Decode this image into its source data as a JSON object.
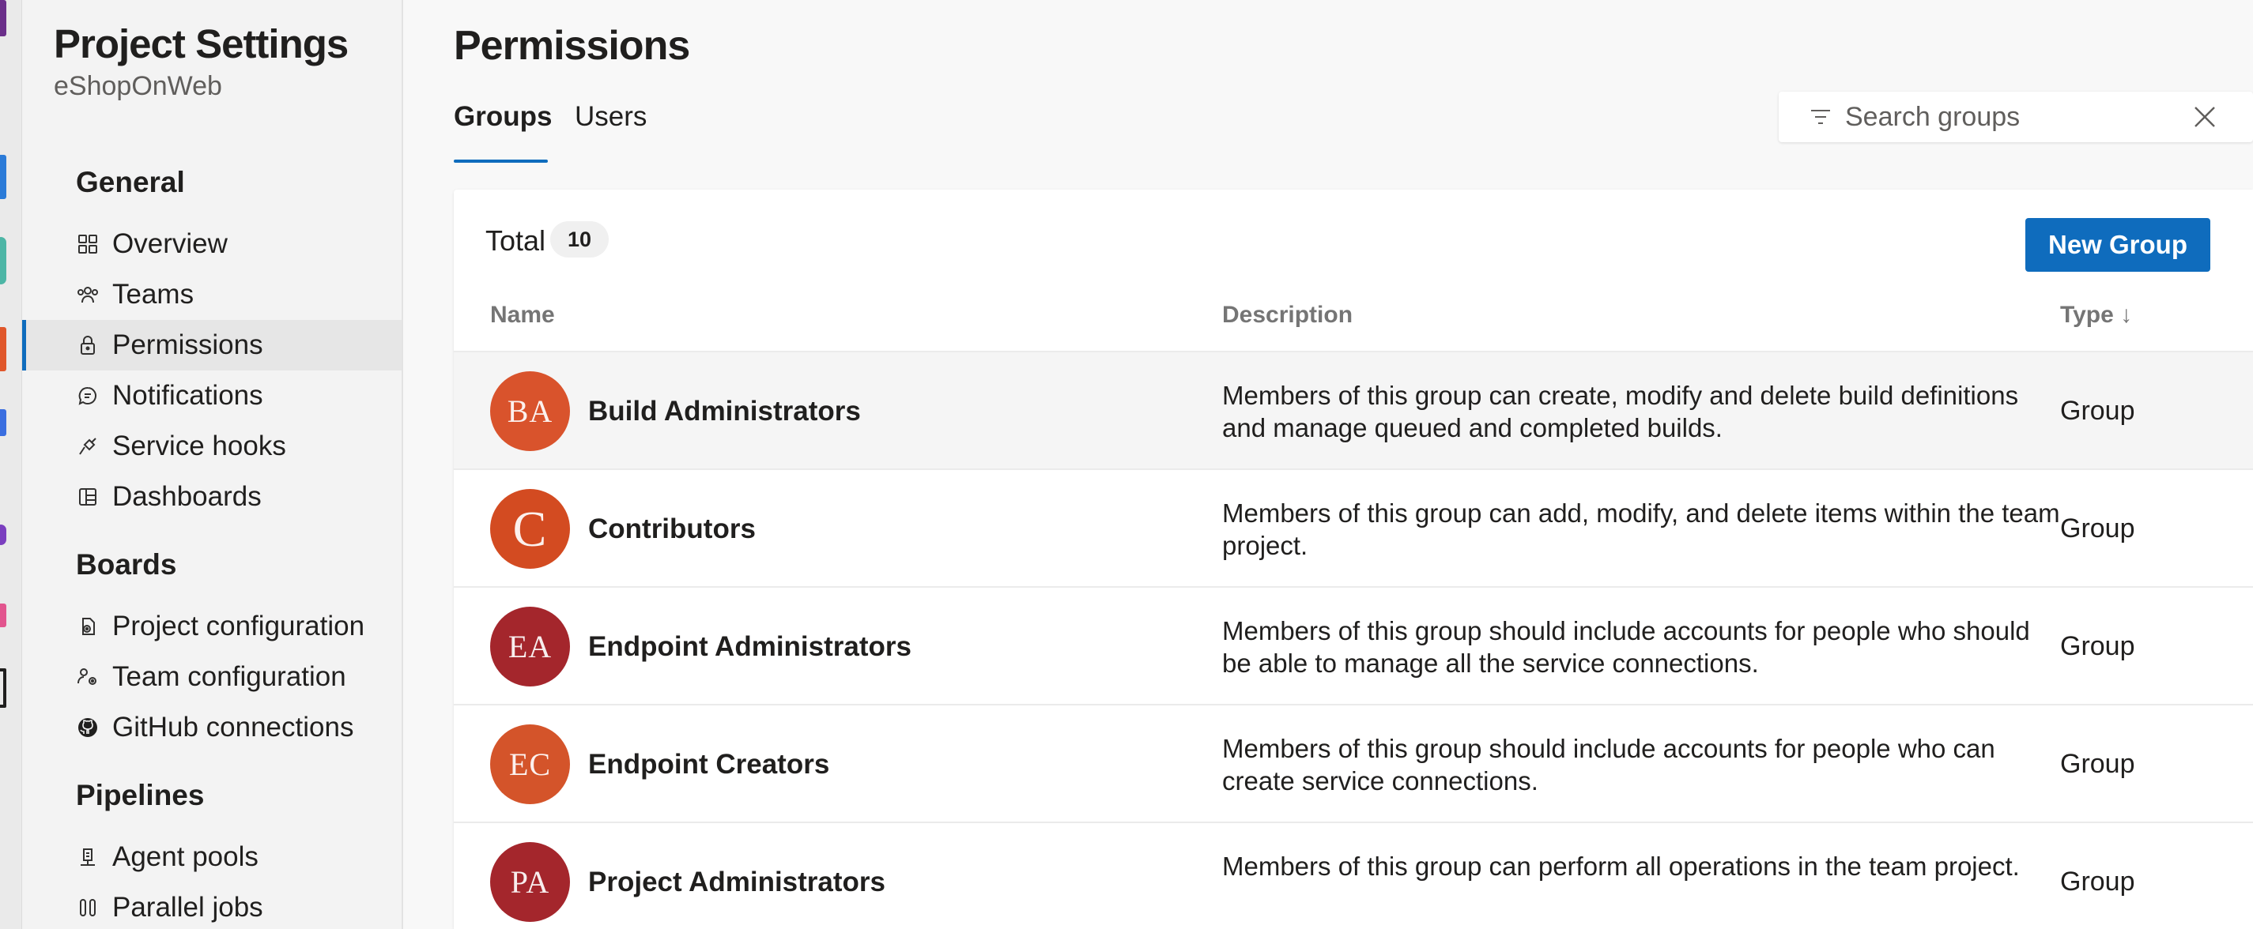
{
  "sidebar": {
    "title": "Project Settings",
    "subtitle": "eShopOnWeb",
    "sections": {
      "general": "General",
      "boards": "Boards",
      "pipelines": "Pipelines"
    },
    "general_items": [
      {
        "label": "Overview",
        "icon": "overview-icon"
      },
      {
        "label": "Teams",
        "icon": "teams-icon"
      },
      {
        "label": "Permissions",
        "icon": "lock-icon",
        "selected": true
      },
      {
        "label": "Notifications",
        "icon": "chat-bubble-icon"
      },
      {
        "label": "Service hooks",
        "icon": "plug-icon"
      },
      {
        "label": "Dashboards",
        "icon": "dashboard-icon"
      }
    ],
    "boards_items": [
      {
        "label": "Project configuration",
        "icon": "gear-doc-icon"
      },
      {
        "label": "Team configuration",
        "icon": "team-gear-icon"
      },
      {
        "label": "GitHub connections",
        "icon": "github-icon"
      }
    ],
    "pipelines_items": [
      {
        "label": "Agent pools",
        "icon": "agent-pool-icon"
      },
      {
        "label": "Parallel jobs",
        "icon": "parallel-jobs-icon"
      }
    ]
  },
  "main": {
    "title": "Permissions",
    "tabs": [
      {
        "label": "Groups",
        "active": true
      },
      {
        "label": "Users",
        "active": false
      }
    ],
    "search": {
      "placeholder": "Search groups",
      "value": ""
    },
    "total_label": "Total",
    "total_count": "10",
    "new_group_label": "New Group",
    "columns": {
      "name": "Name",
      "description": "Description",
      "type": "Type ↓"
    },
    "rows": [
      {
        "initials": "BA",
        "name": "Build Administrators",
        "description": "Members of this group can create, modify and delete build definitions and manage queued and completed builds.",
        "type": "Group",
        "color": "#d9532c"
      },
      {
        "initials": "C",
        "name": "Contributors",
        "description": "Members of this group can add, modify, and delete items within the team project.",
        "type": "Group",
        "color": "#d34b21"
      },
      {
        "initials": "EA",
        "name": "Endpoint Administrators",
        "description": "Members of this group should include accounts for people who should be able to manage all the service connections.",
        "type": "Group",
        "color": "#a4262c"
      },
      {
        "initials": "EC",
        "name": "Endpoint Creators",
        "description": "Members of this group should include accounts for people who can create service connections.",
        "type": "Group",
        "color": "#d4542a"
      },
      {
        "initials": "PA",
        "name": "Project Administrators",
        "description": "Members of this group can perform all operations in the team project.",
        "type": "Group",
        "color": "#a4262c"
      }
    ]
  },
  "colors": {
    "accent": "#0f6cbd",
    "sidebar_bg": "#f3f3f3",
    "selected_bg": "#e6e6e6"
  }
}
